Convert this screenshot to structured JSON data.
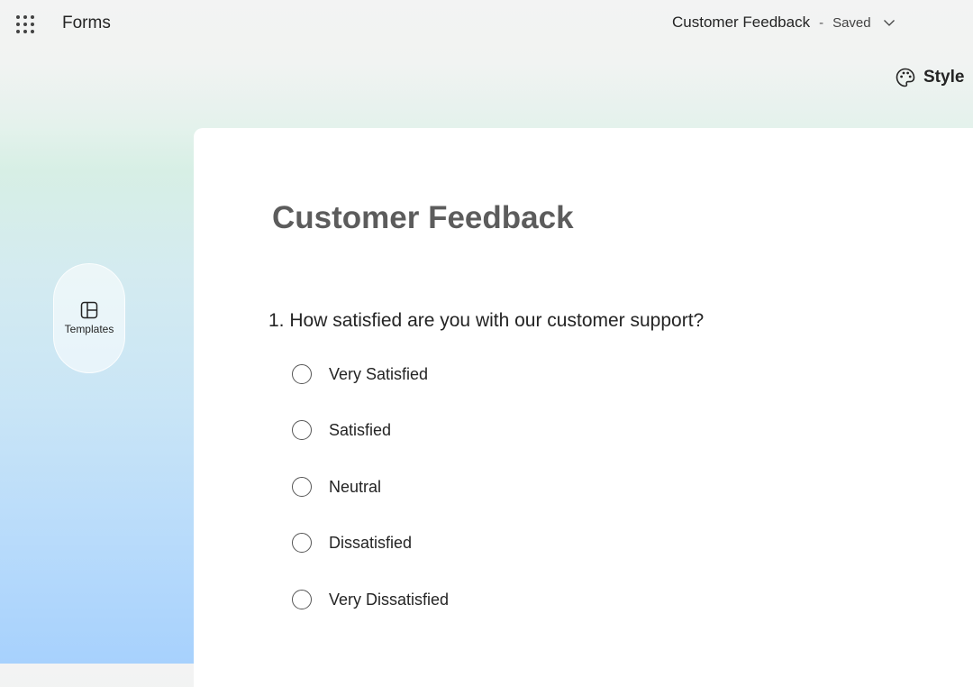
{
  "app": {
    "name": "Forms"
  },
  "header": {
    "form_name": "Customer Feedback",
    "separator": "-",
    "save_status": "Saved",
    "style_label": "Style"
  },
  "sidebar": {
    "templates_label": "Templates"
  },
  "form": {
    "title": "Customer Feedback",
    "questions": [
      {
        "label": "1. How satisfied are you with our customer support?",
        "options": [
          "Very Satisfied",
          "Satisfied",
          "Neutral",
          "Dissatisfied",
          "Very Dissatisfied"
        ]
      }
    ]
  },
  "icons": {
    "waffle": "app-launcher-icon",
    "chevron": "chevron-down-icon",
    "style": "palette-icon",
    "templates": "layout-icon"
  },
  "colors": {
    "title_gray": "#5c5c5c",
    "text": "#242424",
    "card_bg": "#ffffff"
  }
}
